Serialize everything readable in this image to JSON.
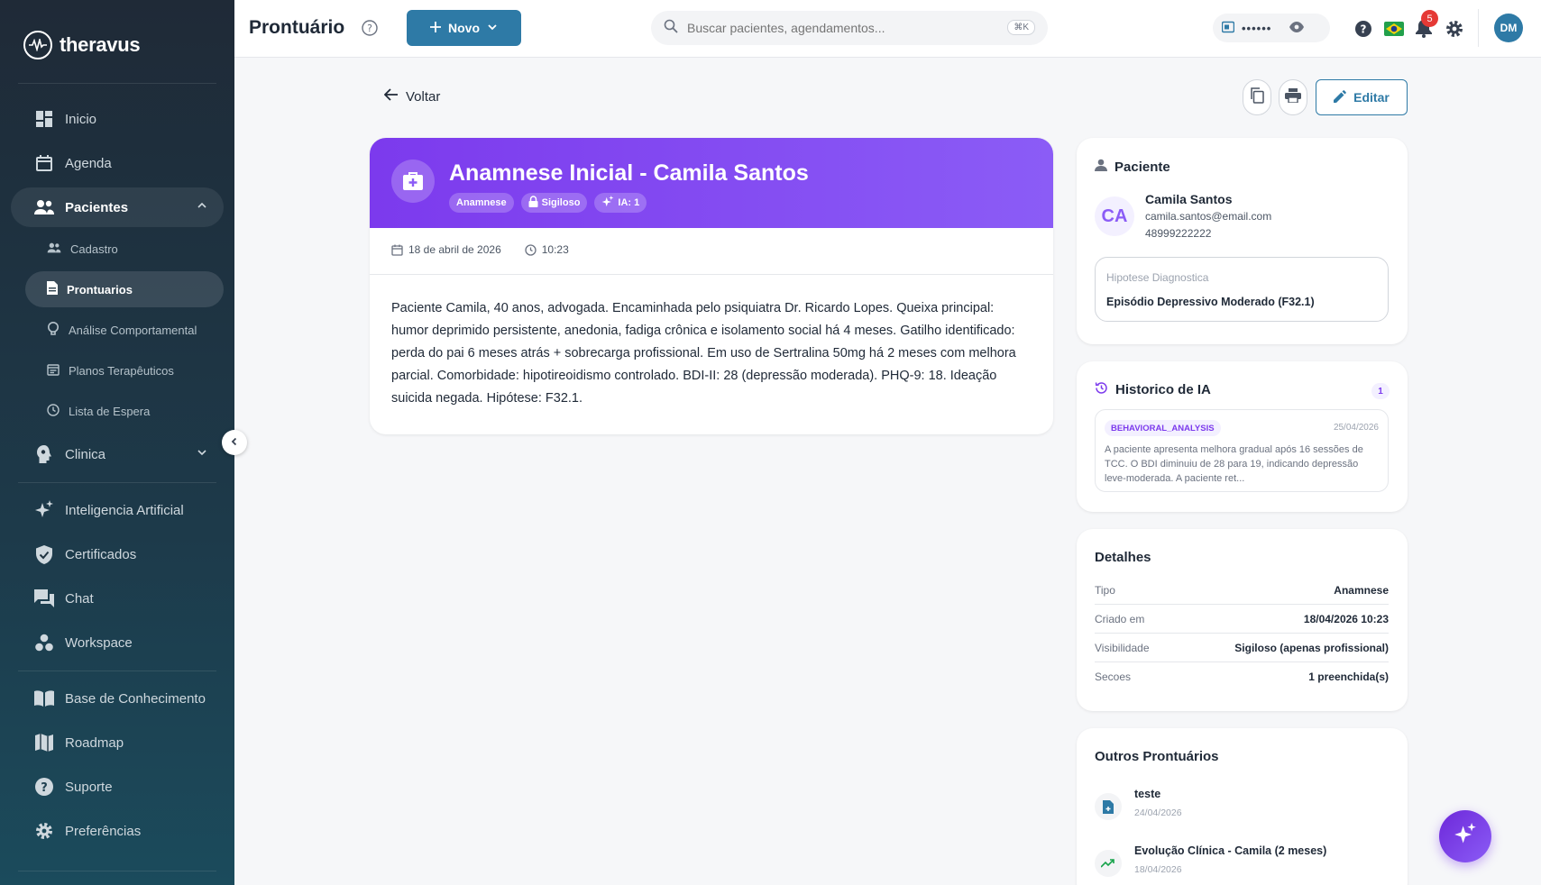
{
  "app": {
    "name": "theravus"
  },
  "sidebar": {
    "items": [
      {
        "label": "Inicio"
      },
      {
        "label": "Agenda"
      },
      {
        "label": "Pacientes"
      },
      {
        "label": "Clinica"
      },
      {
        "label": "Inteligencia Artificial"
      },
      {
        "label": "Certificados"
      },
      {
        "label": "Chat"
      },
      {
        "label": "Workspace"
      },
      {
        "label": "Base de Conhecimento"
      },
      {
        "label": "Roadmap"
      },
      {
        "label": "Suporte"
      },
      {
        "label": "Preferências"
      }
    ],
    "sub_items": [
      {
        "label": "Cadastro"
      },
      {
        "label": "Prontuarios"
      },
      {
        "label": "Análise Comportamental"
      },
      {
        "label": "Planos Terapêuticos"
      },
      {
        "label": "Lista de Espera"
      }
    ]
  },
  "topbar": {
    "title": "Prontuário",
    "new_label": "Novo",
    "search_placeholder": "Buscar pacientes, agendamentos...",
    "shortcut": "⌘K",
    "masked_value": "••••••",
    "notifications_count": "5",
    "avatar_initials": "DM"
  },
  "toolbar": {
    "back_label": "Voltar",
    "edit_label": "Editar"
  },
  "record": {
    "title": "Anamnese Inicial - Camila Santos",
    "chips": [
      "Anamnese",
      "Sigiloso",
      "IA: 1"
    ],
    "date": "18 de abril de 2026",
    "time": "10:23",
    "body": "Paciente Camila, 40 anos, advogada. Encaminhada pelo psiquiatra Dr. Ricardo Lopes. Queixa principal: humor deprimido persistente, anedonia, fadiga crônica e isolamento social há 4 meses. Gatilho identificado: perda do pai 6 meses atrás + sobrecarga profissional. Em uso de Sertralina 50mg há 2 meses com melhora parcial. Comorbidade: hipotireoidismo controlado. BDI-II: 28 (depressão moderada). PHQ-9: 18. Ideação suicida negada. Hipótese: F32.1."
  },
  "patient": {
    "section_title": "Paciente",
    "initials": "CA",
    "name": "Camila Santos",
    "email": "camila.santos@email.com",
    "phone": "48999222222",
    "diagnosis_label": "Hipotese Diagnostica",
    "diagnosis_value": "Episódio Depressivo Moderado (F32.1)"
  },
  "ai_history": {
    "section_title": "Historico de IA",
    "count": "1",
    "items": [
      {
        "tag": "BEHAVIORAL_ANALYSIS",
        "date": "25/04/2026",
        "text": "A paciente apresenta melhora gradual após 16 sessões de TCC. O BDI diminuiu de 28 para 19, indicando depressão leve-moderada. A paciente ret..."
      }
    ]
  },
  "details": {
    "section_title": "Detalhes",
    "rows": [
      {
        "key": "Tipo",
        "value": "Anamnese"
      },
      {
        "key": "Criado em",
        "value": "18/04/2026 10:23"
      },
      {
        "key": "Visibilidade",
        "value": "Sigiloso (apenas profissional)"
      },
      {
        "key": "Secoes",
        "value": "1 preenchida(s)"
      }
    ]
  },
  "other_records": {
    "section_title": "Outros Prontuários",
    "items": [
      {
        "name": "teste",
        "date": "24/04/2026"
      },
      {
        "name": "Evolução Clínica - Camila (2 meses)",
        "date": "18/04/2026"
      }
    ]
  },
  "colors": {
    "accent": "#2e7aa6",
    "purple": "#7c3aed",
    "sidebar_bg": "#1f2a37"
  }
}
